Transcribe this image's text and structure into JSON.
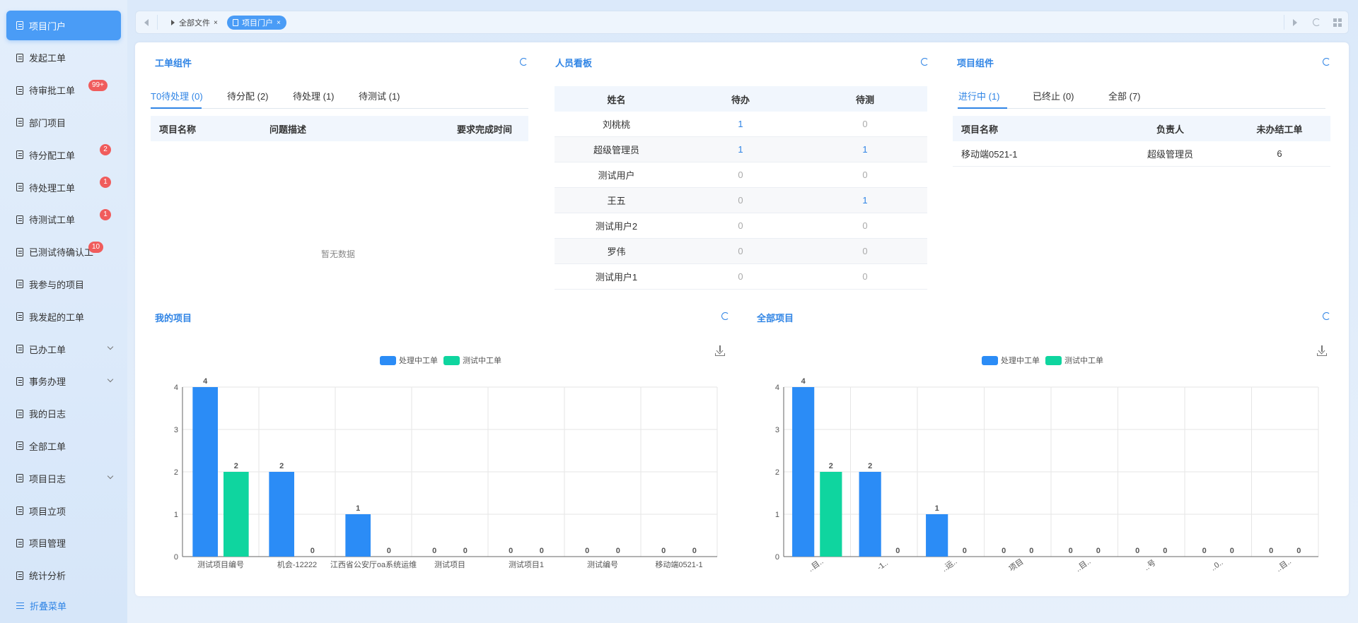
{
  "sidebar": {
    "items": [
      {
        "label": "项目门户",
        "active": true
      },
      {
        "label": "发起工单"
      },
      {
        "label": "待审批工单",
        "badge": "99+"
      },
      {
        "label": "部门项目"
      },
      {
        "label": "待分配工单",
        "badge": "2"
      },
      {
        "label": "待处理工单",
        "badge": "1"
      },
      {
        "label": "待测试工单",
        "badge": "1"
      },
      {
        "label": "已测试待确认工",
        "badge": "10"
      },
      {
        "label": "我参与的项目"
      },
      {
        "label": "我发起的工单"
      },
      {
        "label": "已办工单",
        "expandable": true
      },
      {
        "label": "事务办理",
        "expandable": true
      },
      {
        "label": "我的日志"
      },
      {
        "label": "全部工单"
      },
      {
        "label": "项目日志",
        "expandable": true
      },
      {
        "label": "项目立项"
      },
      {
        "label": "项目管理"
      },
      {
        "label": "统计分析"
      }
    ],
    "collapse_label": "折叠菜单"
  },
  "tabs": [
    {
      "label": "全部文件",
      "close": "×"
    },
    {
      "label": "项目门户",
      "close": "×",
      "active": true
    }
  ],
  "workorder": {
    "title": "工单组件",
    "tabs": [
      "T0待处理 (0)",
      "待分配 (2)",
      "待处理 (1)",
      "待测试 (1)"
    ],
    "columns": [
      "项目名称",
      "问题描述",
      "要求完成时间"
    ],
    "empty_text": "暂无数据"
  },
  "kanban": {
    "title": "人员看板",
    "columns": [
      "姓名",
      "待办",
      "待测"
    ],
    "rows": [
      {
        "name": "刘桃桃",
        "todo": "1",
        "test": "0"
      },
      {
        "name": "超级管理员",
        "todo": "1",
        "test": "1"
      },
      {
        "name": "测试用户",
        "todo": "0",
        "test": "0"
      },
      {
        "name": "王五",
        "todo": "0",
        "test": "1"
      },
      {
        "name": "测试用户2",
        "todo": "0",
        "test": "0"
      },
      {
        "name": "罗伟",
        "todo": "0",
        "test": "0"
      },
      {
        "name": "测试用户1",
        "todo": "0",
        "test": "0"
      }
    ]
  },
  "project_component": {
    "title": "项目组件",
    "tabs": [
      "进行中 (1)",
      "已终止 (0)",
      "全部 (7)"
    ],
    "columns": [
      "项目名称",
      "负责人",
      "未办结工单"
    ],
    "rows": [
      {
        "name": "移动端0521-1",
        "owner": "超级管理员",
        "open": "6"
      }
    ]
  },
  "my_projects": {
    "title": "我的项目"
  },
  "all_projects": {
    "title": "全部项目"
  },
  "colors": {
    "processing": "#2b8cf6",
    "testing": "#0fd59f",
    "accent": "#2f84e5"
  },
  "chart_data": [
    {
      "type": "bar",
      "title": "",
      "legend": [
        "处理中工单",
        "测试中工单"
      ],
      "categories": [
        "测试项目编号",
        "机会-12222",
        "江西省公安厅oa系统运维",
        "测试项目",
        "测试项目1",
        "测试编号",
        "移动端0521-1"
      ],
      "series": [
        {
          "name": "处理中工单",
          "values": [
            4,
            2,
            1,
            0,
            0,
            0,
            0
          ]
        },
        {
          "name": "测试中工单",
          "values": [
            2,
            0,
            0,
            0,
            0,
            0,
            0
          ]
        }
      ],
      "ylim": [
        0,
        4
      ],
      "yticks": [
        0,
        1,
        2,
        3,
        4
      ],
      "grid": true,
      "legend_position": "top-center"
    },
    {
      "type": "bar",
      "title": "",
      "legend": [
        "处理中工单",
        "测试中工单"
      ],
      "categories": [
        "..目..",
        "-1..",
        "..运..",
        "项目",
        "..目..",
        "..号",
        "..0..",
        "..目.."
      ],
      "series": [
        {
          "name": "处理中工单",
          "values": [
            4,
            2,
            1,
            0,
            0,
            0,
            0,
            0
          ]
        },
        {
          "name": "测试中工单",
          "values": [
            2,
            0,
            0,
            0,
            0,
            0,
            0,
            0
          ]
        }
      ],
      "ylim": [
        0,
        4
      ],
      "yticks": [
        0,
        1,
        2,
        3,
        4
      ],
      "grid": true,
      "legend_position": "top-center"
    }
  ]
}
